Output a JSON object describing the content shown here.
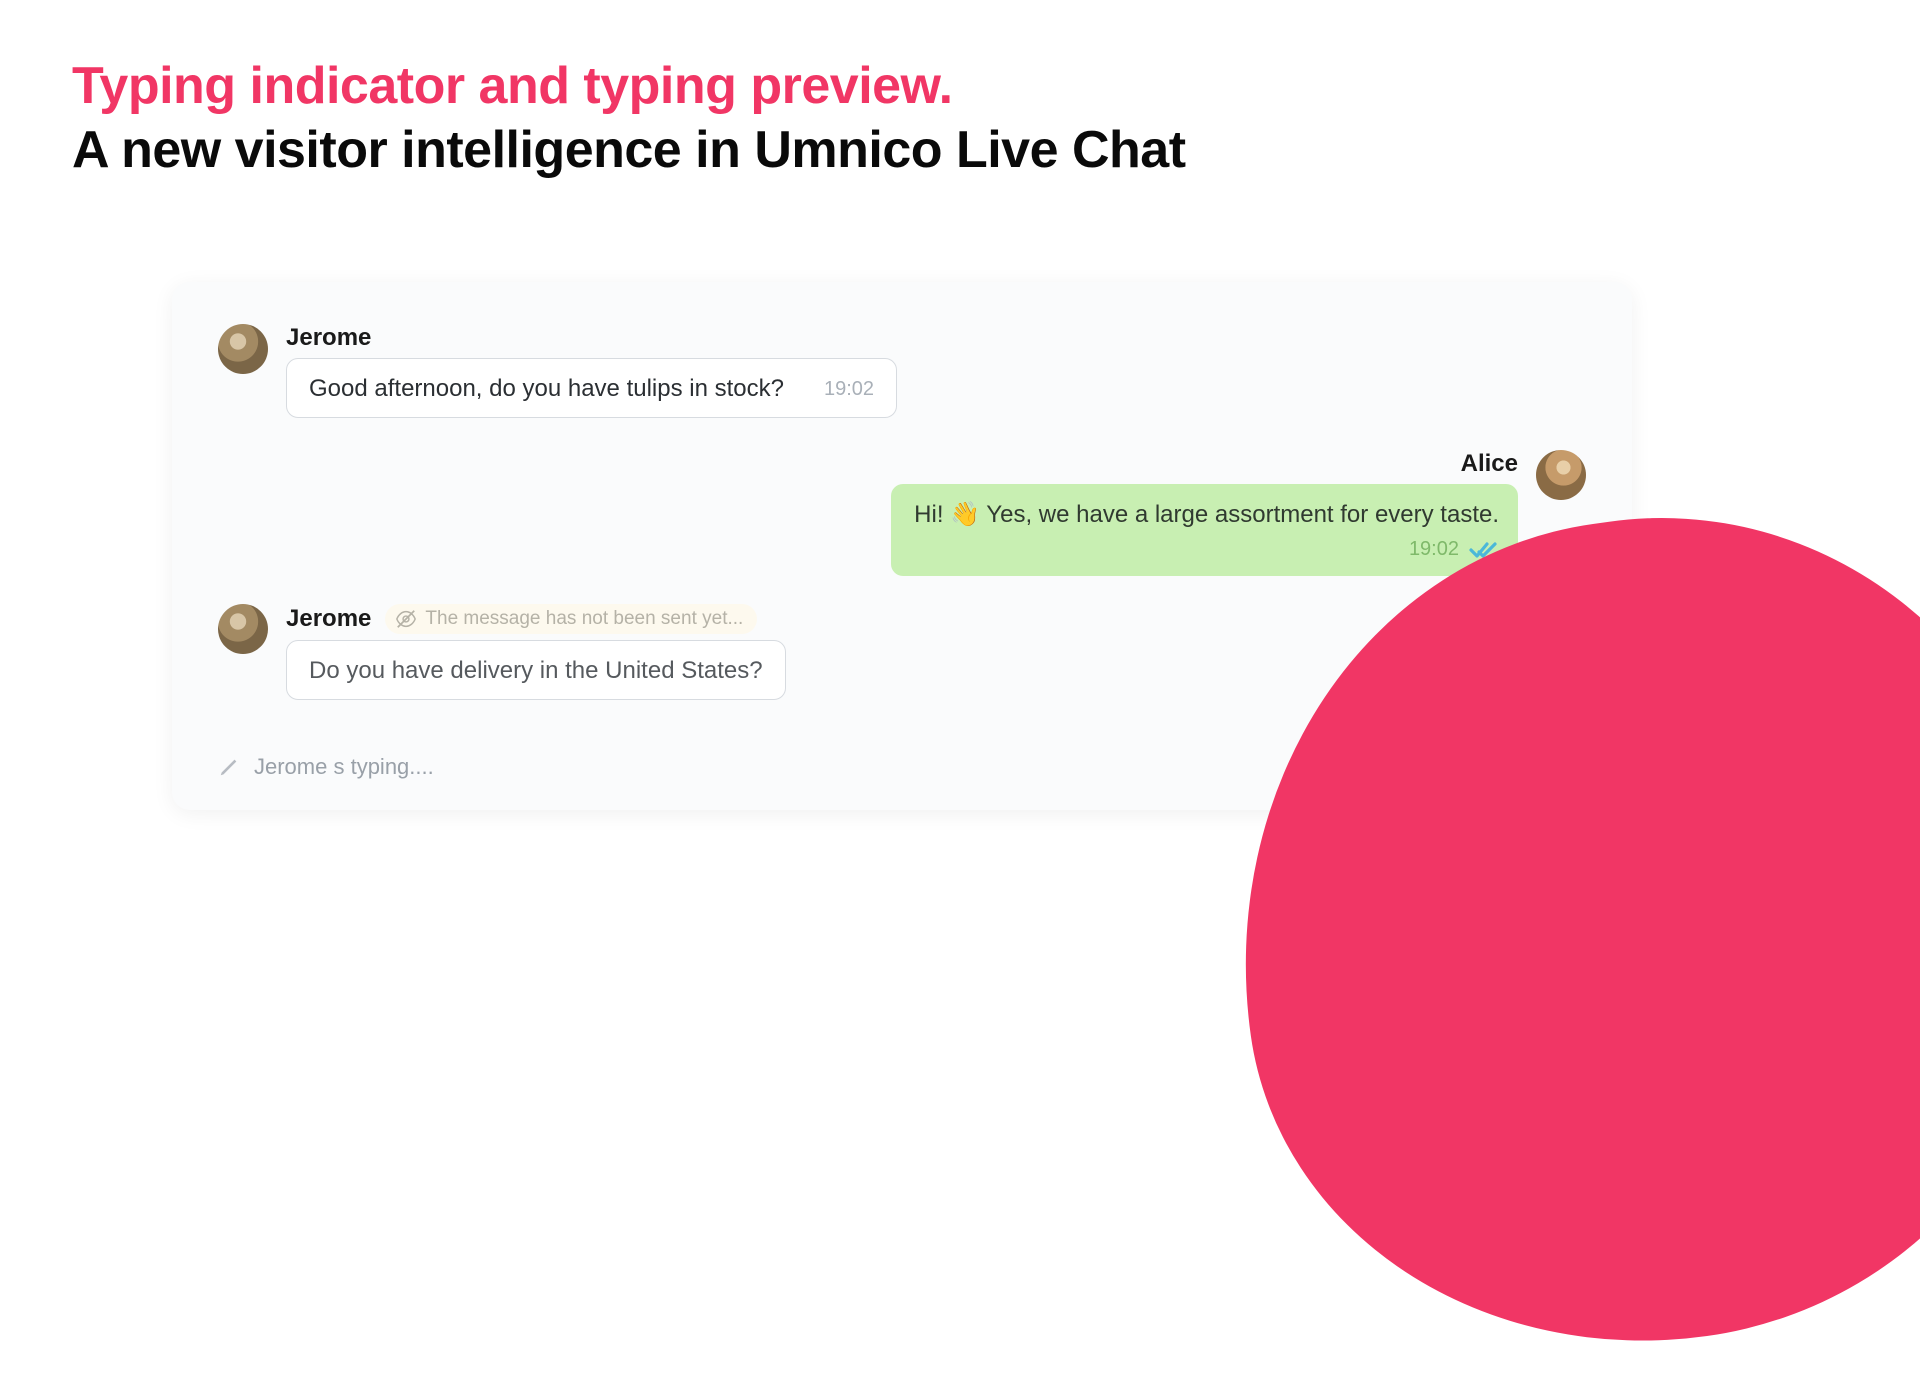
{
  "headline": {
    "accent": "Typing indicator and typing preview.",
    "sub": "A new visitor intelligence in Umnico Live Chat"
  },
  "chat": {
    "messages": [
      {
        "side": "left",
        "sender": "Jerome",
        "text": "Good afternoon, do you have tulips in stock?",
        "time": "19:02"
      },
      {
        "side": "right",
        "sender": "Alice",
        "text": "Hi! 👋  Yes, we have a large assortment for every taste.",
        "time": "19:02",
        "status": "read"
      },
      {
        "side": "left",
        "sender": "Jerome",
        "preview_badge_text": "The message has not been sent yet...",
        "text": "Do you have delivery in the United States?",
        "time": "",
        "is_preview": true
      }
    ],
    "typing_indicator": "Jerome s typing...."
  },
  "colors": {
    "accent": "#f13665",
    "bubble_green": "#c8efb2"
  }
}
